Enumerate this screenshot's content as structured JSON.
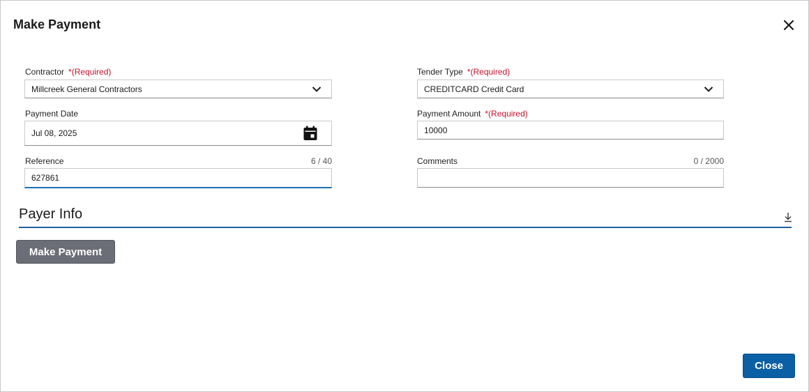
{
  "dialog": {
    "title": "Make Payment",
    "close_icon": "close-icon"
  },
  "form": {
    "required_marker": "*(Required)",
    "contractor": {
      "label": "Contractor",
      "value": "Millcreek General Contractors",
      "icon": "chevron-down-icon"
    },
    "tender_type": {
      "label": "Tender Type",
      "value": "CREDITCARD Credit Card",
      "icon": "chevron-down-icon"
    },
    "payment_date": {
      "label": "Payment Date",
      "value": "Jul 08, 2025",
      "icon": "calendar-icon"
    },
    "payment_amount": {
      "label": "Payment Amount",
      "value": "10000"
    },
    "reference": {
      "label": "Reference",
      "value": "627861",
      "counter": "6 / 40"
    },
    "comments": {
      "label": "Comments",
      "value": "",
      "counter": "0 / 2000"
    }
  },
  "payer_info": {
    "title": "Payer Info",
    "icon": "collapse-arrow-icon",
    "accent_color": "#1f5f9f"
  },
  "actions": {
    "make_payment_label": "Make Payment",
    "close_label": "Close",
    "make_payment_color": "#6b6e76",
    "close_color": "#0b5fa5"
  }
}
